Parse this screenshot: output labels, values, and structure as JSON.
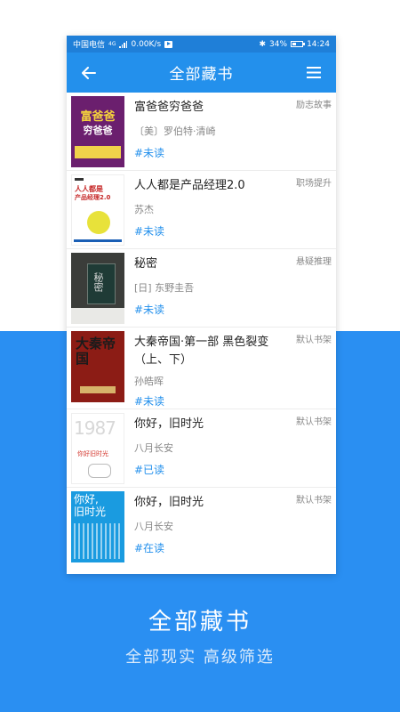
{
  "status_bar": {
    "carrier": "中国电信",
    "net_type": "4G",
    "speed": "0.00K/s",
    "battery": "34%",
    "time": "14:24"
  },
  "header": {
    "title": "全部藏书",
    "back_icon": "arrow-left-icon",
    "menu_icon": "hamburger-menu-icon"
  },
  "books": [
    {
      "title": "富爸爸穷爸爸",
      "author": "〔美〕罗伯特·清崎",
      "status": "#未读",
      "shelf": "励志故事",
      "cover_text": [
        "富爸爸",
        "穷爸爸"
      ]
    },
    {
      "title": "人人都是产品经理2.0",
      "author": "苏杰",
      "status": "#未读",
      "shelf": "职场提升",
      "cover_text": [
        "人人都是",
        "产品经理2.0"
      ]
    },
    {
      "title": "秘密",
      "author": "[日] 东野圭吾",
      "status": "#未读",
      "shelf": "悬疑推理",
      "cover_text": [
        "秘密"
      ]
    },
    {
      "title": "大秦帝国·第一部 黑色裂变（上、下）",
      "author": "孙皓晖",
      "status": "#未读",
      "shelf": "默认书架",
      "cover_text": [
        "大秦帝国"
      ]
    },
    {
      "title": "你好，旧时光",
      "author": "八月长安",
      "status": "#已读",
      "shelf": "默认书架",
      "cover_text": [
        "1987",
        "你好旧时光"
      ]
    },
    {
      "title": "你好，旧时光",
      "author": "八月长安",
      "status": "#在读",
      "shelf": "默认书架",
      "cover_text": [
        "你好,",
        "旧时光"
      ]
    }
  ],
  "promo": {
    "title": "全部藏书",
    "subtitle": "全部现实  高级筛选"
  },
  "colors": {
    "accent": "#2390ec",
    "background_blue": "#2a8ff2"
  }
}
